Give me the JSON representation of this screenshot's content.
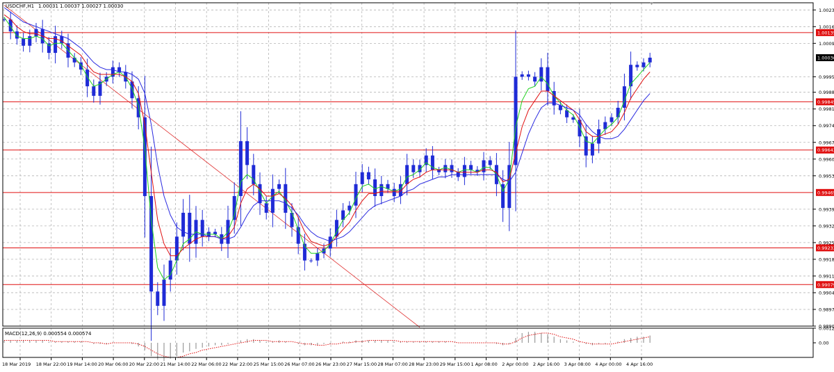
{
  "header": {
    "symbol_label": "USDCHF,H1",
    "quote_values": "1.00031 1.00037 1.00027 1.00030"
  },
  "indicator": {
    "label": "MACD(12,26,9) 0.000554 0.000574"
  },
  "colors": {
    "background": "#ffffff",
    "frame": "#000000",
    "grid": "#b4b4b4",
    "candles": "#1f2bd6",
    "ma_fast": "#1fd11f",
    "ma_mid": "#e01010",
    "ma_slow": "#2a2ae0",
    "levels": "#e01010",
    "level_tag_bg": "#e01010",
    "level_tag_text": "#ffffff",
    "price_tag_bg": "#000000",
    "trendline": "#e03030",
    "macd_hist": "#9a9a9a",
    "macd_signal": "#e01010"
  },
  "chart_data": [
    {
      "type": "candlestick",
      "title": "USDCHF,H1",
      "subtitle": "1.00031 1.00037 1.00027 1.00030",
      "grid": true,
      "ylim": [
        0.98905,
        1.0026
      ],
      "y_ticks": [
        "1.00230",
        "1.00160",
        "1.00090",
        "0.99950",
        "0.99885",
        "0.99815",
        "0.99745",
        "0.99675",
        "0.99605",
        "0.99535",
        "0.99395",
        "0.99325",
        "0.99255",
        "0.99185",
        "0.99115",
        "0.99045",
        "0.98975",
        "0.98905"
      ],
      "current_price": "1.00030",
      "horizontal_levels": [
        "1.00135",
        "0.99845",
        "0.99643",
        "0.99465",
        "0.99233",
        "0.99079"
      ],
      "x_ticks": [
        "18 Mar 2019",
        "18 Mar 22:00",
        "19 Mar 14:00",
        "20 Mar 06:00",
        "20 Mar 22:00",
        "21 Mar 14:00",
        "22 Mar 06:00",
        "22 Mar 22:00",
        "25 Mar 15:00",
        "26 Mar 07:00",
        "26 Mar 23:00",
        "27 Mar 15:00",
        "28 Mar 07:00",
        "28 Mar 23:00",
        "29 Mar 15:00",
        "1 Apr 08:00",
        "2 Apr 00:00",
        "2 Apr 16:00",
        "3 Apr 08:00",
        "4 Apr 00:00",
        "4 Apr 16:00"
      ],
      "series": [
        {
          "name": "",
          "style": "candles",
          "closes": [
            1.0019,
            1.0014,
            1.0011,
            1.0008,
            1.0012,
            1.0015,
            1.0009,
            1.0005,
            1.0012,
            1.0009,
            1.0003,
            1.0001,
            0.9998,
            0.9991,
            0.9987,
            0.9993,
            0.9995,
            0.9999,
            0.9997,
            0.9993,
            0.9986,
            0.9978,
            0.9945,
            0.9905,
            0.9899,
            0.991,
            0.9918,
            0.9928,
            0.9938,
            0.9925,
            0.9935,
            0.9928,
            0.993,
            0.9929,
            0.9925,
            0.9935,
            0.9945,
            0.9968,
            0.9958,
            0.995,
            0.9942,
            0.9938,
            0.9948,
            0.995,
            0.9938,
            0.9932,
            0.9925,
            0.9918,
            0.9918,
            0.9921,
            0.9923,
            0.9928,
            0.9935,
            0.9939,
            0.9941,
            0.995,
            0.9955,
            0.9952,
            0.9945,
            0.995,
            0.9948,
            0.9945,
            0.995,
            0.9958,
            0.9955,
            0.9958,
            0.9962,
            0.9956,
            0.9955,
            0.9958,
            0.9955,
            0.9953,
            0.9958,
            0.9956,
            0.9955,
            0.996,
            0.9958,
            0.995,
            0.994,
            0.9958,
            0.9995,
            0.9996,
            0.9995,
            0.9993,
            0.9999,
            0.9989,
            0.9983,
            0.9981,
            0.9978,
            0.9977,
            0.997,
            0.9962,
            0.9967,
            0.9973,
            0.9976,
            0.9978,
            0.9982,
            0.9991,
            1.0,
            0.9999,
            1.0001,
            1.0003
          ]
        },
        {
          "name": "",
          "style": "line",
          "role": "ma_fast",
          "values": [
            1.002,
            1.0016,
            1.0012,
            1.0011,
            1.0011,
            1.0012,
            1.0011,
            1.0008,
            1.0009,
            1.0009,
            1.0006,
            1.0003,
            1.0,
            0.9995,
            0.9991,
            0.9992,
            0.9994,
            0.9996,
            0.9997,
            0.9995,
            0.999,
            0.9983,
            0.9965,
            0.9935,
            0.9915,
            0.991,
            0.9912,
            0.9918,
            0.9925,
            0.9927,
            0.993,
            0.9929,
            0.9929,
            0.9929,
            0.9927,
            0.993,
            0.9937,
            0.9951,
            0.9954,
            0.9952,
            0.9947,
            0.9942,
            0.9945,
            0.9947,
            0.9943,
            0.9938,
            0.9931,
            0.9924,
            0.9921,
            0.9921,
            0.9922,
            0.9925,
            0.993,
            0.9935,
            0.9938,
            0.9944,
            0.9949,
            0.995,
            0.9948,
            0.9949,
            0.9948,
            0.9947,
            0.9948,
            0.9953,
            0.9954,
            0.9956,
            0.9959,
            0.9957,
            0.9956,
            0.9957,
            0.9956,
            0.9955,
            0.9956,
            0.9956,
            0.9955,
            0.9957,
            0.9957,
            0.9954,
            0.9947,
            0.9952,
            0.9974,
            0.9985,
            0.999,
            0.9991,
            0.9995,
            0.9992,
            0.9987,
            0.9984,
            0.9981,
            0.9979,
            0.9974,
            0.9968,
            0.9967,
            0.997,
            0.9973,
            0.9975,
            0.9978,
            0.9985,
            0.9992,
            0.9995,
            0.9998,
            1.0001
          ]
        },
        {
          "name": "",
          "style": "line",
          "role": "ma_mid",
          "values": [
            1.0021,
            1.0019,
            1.0016,
            1.0014,
            1.0013,
            1.0013,
            1.0012,
            1.0011,
            1.0011,
            1.001,
            1.0008,
            1.0006,
            1.0004,
            1.0,
            0.9997,
            0.9996,
            0.9996,
            0.9996,
            0.9996,
            0.9995,
            0.9993,
            0.9988,
            0.9975,
            0.9955,
            0.9935,
            0.9925,
            0.992,
            0.992,
            0.9923,
            0.9925,
            0.9927,
            0.9928,
            0.9928,
            0.9928,
            0.9927,
            0.9928,
            0.9932,
            0.9942,
            0.9948,
            0.995,
            0.9948,
            0.9945,
            0.9945,
            0.9946,
            0.9944,
            0.9941,
            0.9936,
            0.993,
            0.9926,
            0.9925,
            0.9924,
            0.9925,
            0.9928,
            0.9931,
            0.9934,
            0.9939,
            0.9943,
            0.9946,
            0.9946,
            0.9947,
            0.9947,
            0.9947,
            0.9947,
            0.995,
            0.9952,
            0.9953,
            0.9955,
            0.9956,
            0.9956,
            0.9956,
            0.9956,
            0.9955,
            0.9955,
            0.9955,
            0.9955,
            0.9956,
            0.9956,
            0.9955,
            0.9951,
            0.9952,
            0.9963,
            0.9974,
            0.9981,
            0.9985,
            0.9989,
            0.9989,
            0.9987,
            0.9985,
            0.9983,
            0.9981,
            0.9977,
            0.9972,
            0.997,
            0.997,
            0.9971,
            0.9972,
            0.9975,
            0.998,
            0.9986,
            0.999,
            0.9994,
            0.9997
          ]
        },
        {
          "name": "",
          "style": "line",
          "role": "ma_slow",
          "values": [
            1.0024,
            1.0022,
            1.002,
            1.0018,
            1.0017,
            1.0016,
            1.0015,
            1.0014,
            1.0013,
            1.0012,
            1.0011,
            1.0009,
            1.0007,
            1.0004,
            1.0001,
            0.9999,
            0.9998,
            0.9998,
            0.9997,
            0.9997,
            0.9996,
            0.9994,
            0.9988,
            0.9975,
            0.9958,
            0.9945,
            0.9937,
            0.9932,
            0.993,
            0.9929,
            0.9929,
            0.9929,
            0.9928,
            0.9928,
            0.9927,
            0.9927,
            0.9928,
            0.9932,
            0.9937,
            0.9941,
            0.9943,
            0.9943,
            0.9943,
            0.9943,
            0.9942,
            0.994,
            0.9937,
            0.9933,
            0.993,
            0.9928,
            0.9927,
            0.9926,
            0.9927,
            0.9928,
            0.993,
            0.9933,
            0.9936,
            0.9939,
            0.9941,
            0.9942,
            0.9943,
            0.9944,
            0.9945,
            0.9947,
            0.9948,
            0.995,
            0.9951,
            0.9952,
            0.9953,
            0.9953,
            0.9954,
            0.9954,
            0.9954,
            0.9954,
            0.9954,
            0.9954,
            0.9954,
            0.9954,
            0.9952,
            0.9951,
            0.9955,
            0.9963,
            0.9971,
            0.9977,
            0.9982,
            0.9984,
            0.9984,
            0.9983,
            0.9982,
            0.9981,
            0.9979,
            0.9975,
            0.9972,
            0.997,
            0.9969,
            0.9969,
            0.997,
            0.9973,
            0.9977,
            0.9981,
            0.9985,
            0.9988
          ]
        }
      ],
      "trendline": {
        "start": [
          0,
          1.0025
        ],
        "end": [
          65,
          0.989
        ]
      }
    },
    {
      "type": "bar",
      "title": "MACD(12,26,9) 0.000554 0.000574",
      "ylim": [
        -0.0012,
        0.0012
      ],
      "y_ticks": [
        "0.001204",
        "0.00"
      ],
      "series": [
        {
          "name": "",
          "style": "histogram",
          "values": [
            0.0002,
            0.0002,
            0.0002,
            0.0002,
            0.0002,
            0.0002,
            0.0002,
            0.0001,
            0.0001,
            0.0001,
            0.0001,
            0.0001,
            0.0001,
            0.0,
            -0.0001,
            -0.0001,
            -0.0001,
            0.0,
            0.0,
            0.0,
            -0.0001,
            -0.0003,
            -0.0006,
            -0.0011,
            -0.0014,
            -0.0015,
            -0.0013,
            -0.0011,
            -0.0008,
            -0.0007,
            -0.0005,
            -0.0004,
            -0.0003,
            -0.0002,
            -0.0002,
            -0.0001,
            0.0,
            0.0002,
            0.0003,
            0.0003,
            0.0002,
            0.0001,
            0.0001,
            0.0002,
            0.0001,
            0.0,
            -0.0001,
            -0.0002,
            -0.0002,
            -0.0002,
            -0.0001,
            -0.0001,
            0.0,
            0.0001,
            0.0001,
            0.0002,
            0.0002,
            0.0002,
            0.0002,
            0.0002,
            0.0002,
            0.0001,
            0.0001,
            0.0001,
            0.0001,
            0.0001,
            0.0001,
            0.0001,
            0.0001,
            0.0001,
            0.0,
            0.0,
            0.0,
            0.0,
            0.0,
            0.0,
            0.0,
            -0.0001,
            -0.0002,
            -0.0001,
            0.0004,
            0.0008,
            0.0009,
            0.0009,
            0.0008,
            0.0007,
            0.0005,
            0.0003,
            0.0002,
            0.0001,
            0.0,
            -0.0001,
            -0.0002,
            -0.0001,
            -0.0001,
            0.0,
            0.0001,
            0.0003,
            0.0004,
            0.0005,
            0.0005,
            0.0006
          ]
        },
        {
          "name": "",
          "style": "dotted-line",
          "values": [
            0.0002,
            0.0002,
            0.0002,
            0.0002,
            0.0002,
            0.0002,
            0.0002,
            0.0002,
            0.0001,
            0.0001,
            0.0001,
            0.0001,
            0.0001,
            0.0001,
            0.0,
            0.0,
            -0.0001,
            0.0,
            0.0,
            0.0,
            0.0,
            -0.0001,
            -0.0003,
            -0.0006,
            -0.0009,
            -0.0011,
            -0.0012,
            -0.0012,
            -0.0011,
            -0.0009,
            -0.0008,
            -0.0006,
            -0.0005,
            -0.0004,
            -0.0003,
            -0.0002,
            -0.0001,
            0.0,
            0.0001,
            0.0002,
            0.0002,
            0.0002,
            0.0001,
            0.0001,
            0.0001,
            0.0001,
            0.0,
            -0.0001,
            -0.0001,
            -0.0002,
            -0.0002,
            -0.0001,
            -0.0001,
            0.0,
            0.0,
            0.0001,
            0.0001,
            0.0002,
            0.0002,
            0.0002,
            0.0002,
            0.0002,
            0.0001,
            0.0001,
            0.0001,
            0.0001,
            0.0001,
            0.0001,
            0.0001,
            0.0001,
            0.0001,
            0.0,
            0.0,
            0.0,
            0.0,
            0.0,
            0.0,
            0.0,
            -0.0001,
            -0.0001,
            0.0001,
            0.0004,
            0.0006,
            0.0007,
            0.0008,
            0.0008,
            0.0007,
            0.0005,
            0.0004,
            0.0003,
            0.0001,
            0.0,
            -0.0001,
            -0.0001,
            -0.0001,
            -0.0001,
            0.0,
            0.0001,
            0.0002,
            0.0003,
            0.0004,
            0.0005
          ]
        }
      ]
    }
  ]
}
